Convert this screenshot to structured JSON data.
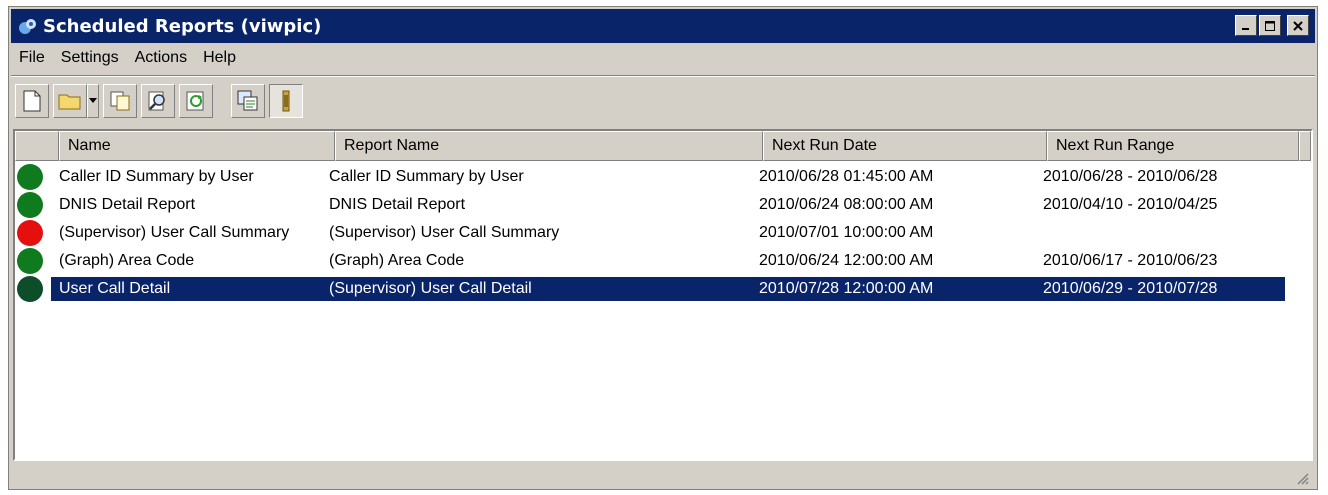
{
  "window": {
    "title": "Scheduled Reports (viwpic)"
  },
  "menu": [
    "File",
    "Settings",
    "Actions",
    "Help"
  ],
  "toolbar": {
    "buttons": [
      "new-report",
      "open-folder",
      "copy",
      "properties-search",
      "refresh",
      "run-report",
      "schedule"
    ]
  },
  "columns": [
    "",
    "Name",
    "Report Name",
    "Next Run Date",
    "Next Run Range"
  ],
  "rows": [
    {
      "status": "#0f7a1e",
      "name": "Caller ID Summary by User",
      "report": "Caller ID Summary by User",
      "date": "2010/06/28  01:45:00 AM",
      "range": "2010/06/28 - 2010/06/28"
    },
    {
      "status": "#0f7a1e",
      "name": "DNIS Detail Report",
      "report": "DNIS Detail Report",
      "date": "2010/06/24  08:00:00 AM",
      "range": "2010/04/10 - 2010/04/25"
    },
    {
      "status": "#e60f0f",
      "name": "(Supervisor) User Call Summary",
      "report": "(Supervisor) User Call Summary",
      "date": "2010/07/01  10:00:00 AM",
      "range": ""
    },
    {
      "status": "#0f7a1e",
      "name": "(Graph) Area Code",
      "report": "(Graph) Area Code",
      "date": "2010/06/24  12:00:00 AM",
      "range": "2010/06/17 - 2010/06/23"
    },
    {
      "status": "#0d4d2a",
      "name": "User Call Detail",
      "report": "(Supervisor) User Call Detail",
      "date": "2010/07/28  12:00:00 AM",
      "range": "2010/06/29 - 2010/07/28",
      "selected": true
    }
  ],
  "colors": {
    "titlebar": "#0a246a",
    "selection": "#0a246a",
    "face": "#d4d0c8"
  }
}
